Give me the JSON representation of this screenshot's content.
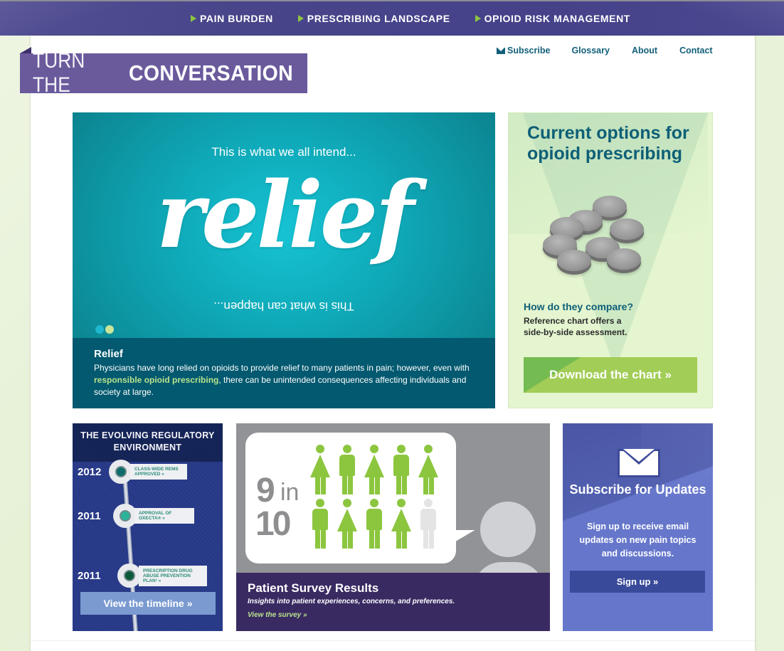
{
  "top_nav": {
    "items": [
      {
        "label": "PAIN BURDEN"
      },
      {
        "label": "PRESCRIBING LANDSCAPE"
      },
      {
        "label": "OPIOID RISK MANAGEMENT"
      }
    ],
    "arrow_color": "#8cc63f"
  },
  "logo": {
    "light": "TURN THE",
    "bold": "CONVERSATION"
  },
  "utility_nav": {
    "subscribe": "Subscribe",
    "glossary": "Glossary",
    "about": "About",
    "contact": "Contact"
  },
  "hero": {
    "top_line": "This is what we all intend...",
    "word": "relief",
    "bottom_line": "This is what can happen...",
    "dots": [
      {
        "color": "#1fb7d0",
        "active": false
      },
      {
        "color": "#c9e59a",
        "active": true
      }
    ],
    "caption": {
      "title": "Relief",
      "text_before": "Physicians have long relied on opioids to provide relief to many patients in pain; however, even with ",
      "link": "responsible opioid prescribing",
      "text_after": ", there can be unintended consequences affecting individuals and society at large."
    }
  },
  "options_card": {
    "title": "Current options for opioid prescribing",
    "subtitle": "How do they compare?",
    "description": "Reference chart offers a side-by-side assessment.",
    "button": "Download the chart »"
  },
  "timeline_card": {
    "title": "THE EVOLVING REGULATORY ENVIRONMENT",
    "events": [
      {
        "year": "2012",
        "label": "CLASS-WIDE REMS APPROVED »",
        "node_color": "#0e6b6b"
      },
      {
        "year": "2011",
        "label": "APPROVAL OF OXECTA® »",
        "node_color": "#2bb39a"
      },
      {
        "year": "2011",
        "label": "PRESCRIPTION DRUG ABUSE PREVENTION PLAN¹ »",
        "node_color": "#0a5a3a"
      }
    ],
    "button": "View the timeline »"
  },
  "survey_card": {
    "stat_number": "9",
    "stat_in": "in",
    "stat_total": "10",
    "people": [
      {
        "type": "female",
        "highlighted": true
      },
      {
        "type": "male",
        "highlighted": true
      },
      {
        "type": "female",
        "highlighted": true
      },
      {
        "type": "male",
        "highlighted": true
      },
      {
        "type": "female",
        "highlighted": true
      },
      {
        "type": "male",
        "highlighted": true
      },
      {
        "type": "female",
        "highlighted": true
      },
      {
        "type": "male",
        "highlighted": true
      },
      {
        "type": "female",
        "highlighted": true
      },
      {
        "type": "male",
        "highlighted": false
      }
    ],
    "highlight_color": "#8cc63f",
    "muted_color": "#e4e4e4",
    "title": "Patient Survey Results",
    "description": "Insights into patient experiences, concerns, and preferences.",
    "link": "View the survey »"
  },
  "subscribe_card": {
    "title": "Subscribe for Updates",
    "description": "Sign up to receive email updates on new pain topics and discussions.",
    "button": "Sign up »"
  }
}
